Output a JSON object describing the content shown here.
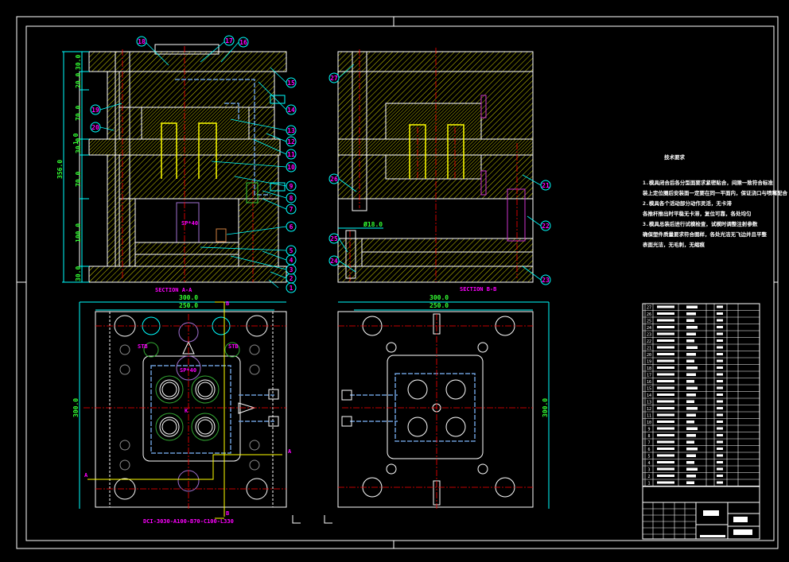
{
  "drawing": {
    "section_a_label": "SECTION A-A",
    "section_b_label": "SECTION B-B",
    "mold_base_code": "DCI-3030-A100-B70-C100-L330",
    "cut_marks": [
      "A",
      "A",
      "B",
      "B"
    ],
    "plan_labels": [
      "STB",
      "STB",
      "SP*40",
      "SP*40",
      "K"
    ],
    "left_dimensions": {
      "total": "356.0",
      "segments": [
        "30.0",
        "20.0",
        "70.0",
        "1.0",
        "30.0",
        "70.0",
        "100.0",
        "30.0"
      ]
    },
    "plan_left": {
      "width_outer": "300.0",
      "width_inner": "250.0",
      "height": "300.0"
    },
    "plan_right": {
      "width_outer": "300.0",
      "width_inner": "250.0",
      "height": "300.0"
    },
    "diameter_note": "Ø18.0"
  },
  "balloons": [
    "1",
    "2",
    "3",
    "4",
    "5",
    "6",
    "7",
    "8",
    "9",
    "10",
    "11",
    "12",
    "13",
    "14",
    "15",
    "16",
    "17",
    "18",
    "19",
    "20",
    "21",
    "22",
    "23",
    "24",
    "25",
    "26",
    "27"
  ],
  "technical_requirements": {
    "title": "技术要求",
    "lines": [
      "1.模具闭合后各分型面要求紧密贴合，间隙一致符合标准",
      "装上定位圈后安装面一定要在同一平面内，保证浇口与喷嘴配合",
      "2.模具各个活动部分动作灵活，无卡滞",
      "各推杆推出时平稳无卡滞，复位可靠，各处均匀",
      "3.模具总装后进行试模检查，试模时调整注射参数",
      "确保塑件质量要求符合图样，各处光洁无飞边并且平整",
      "表面光洁，无毛刺，无缩痕"
    ]
  },
  "parts_list": {
    "row_numbers": [
      "27",
      "26",
      "25",
      "24",
      "23",
      "22",
      "21",
      "20",
      "19",
      "18",
      "17",
      "16",
      "15",
      "14",
      "13",
      "12",
      "11",
      "10",
      "9",
      "8",
      "7",
      "6",
      "5",
      "4",
      "3",
      "2",
      "1"
    ]
  },
  "colors": {
    "background": "#000000",
    "outline": "#ffffff",
    "hatch": "#ffff00",
    "dimension_line": "#00ffff",
    "dimension_text": "#33ff33",
    "centerline": "#ff0000",
    "cooling": "#6a9ad6",
    "annotation": "#ff00ff"
  }
}
